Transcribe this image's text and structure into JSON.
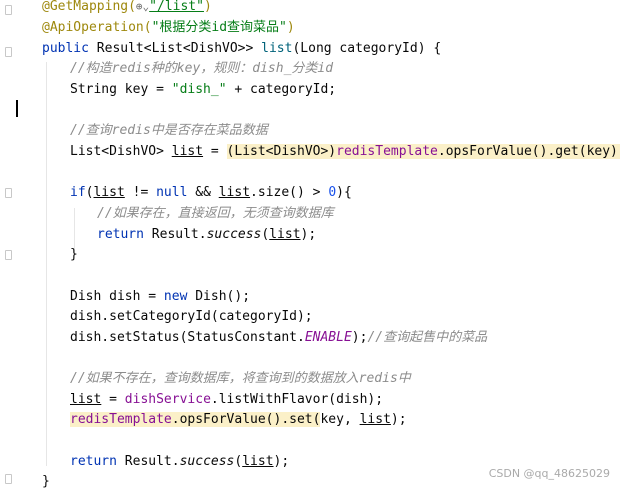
{
  "code": {
    "ann_getmapping": "@GetMapping(",
    "ann_getmapping_icon": "⊕⌄",
    "ann_getmapping_path": "\"/list\"",
    "ann_getmapping_close": ")",
    "ann_apiop": "@ApiOperation(",
    "ann_apiop_value": "\"根据分类id查询菜品\"",
    "ann_apiop_close": ")",
    "sig_public": "public",
    "sig_rest": " Result<List<DishVO>> ",
    "sig_method": "list",
    "sig_params": "(Long categoryId) {",
    "cmt_key": "//构造redis种的key，规则：dish_分类id",
    "key_decl": "String key = ",
    "key_str": "\"dish_\"",
    "key_rest": " + categoryId;",
    "cmt_query": "//查询redis中是否存在菜品数据",
    "list_type": "List<DishVO> ",
    "list_var": "list",
    "list_eq": " = ",
    "list_cast": "(List<DishVO>)",
    "list_tpl": "redisTemplate",
    "list_ops": ".opsForValue().get(key);",
    "if_kw": "if",
    "if_open": "(",
    "if_list1": "list",
    "if_ne": " != ",
    "if_null": "null",
    "if_and": " && ",
    "if_list2": "list",
    "if_size": ".size() > ",
    "if_zero": "0",
    "if_close": "){",
    "cmt_exists": "//如果存在，直接返回，无须查询数据库",
    "ret1_kw": "return",
    "ret1_a": " Result.",
    "ret1_success": "success",
    "ret1_b": "(",
    "ret1_list": "list",
    "ret1_c": ");",
    "close_brace": "}",
    "dish_a": "Dish dish = ",
    "dish_new": "new",
    "dish_b": " Dish();",
    "setcat": "dish.setCategoryId(categoryId);",
    "setstatus_a": "dish.setStatus(StatusConstant.",
    "setstatus_enable": "ENABLE",
    "setstatus_b": ");",
    "cmt_onsale": "//查询起售中的菜品",
    "cmt_notexist": "//如果不存在，查询数据库，将查询到的数据放入redis中",
    "assign_list": "list",
    "assign_eq": " = ",
    "assign_svc": "dishService",
    "assign_rest": ".listWithFlavor(dish);",
    "set_tpl": "redisTemplate",
    "set_ops": ".opsForValue().set(",
    "set_args_a": "key, ",
    "set_args_list": "list",
    "set_args_b": ");",
    "ret2_kw": "return",
    "ret2_a": " Result.",
    "ret2_success": "success",
    "ret2_b": "(",
    "ret2_list": "list",
    "ret2_c": ");",
    "final_brace": "}"
  },
  "watermark": "CSDN @qq_48625029",
  "colors": {
    "keyword": "#0033b3",
    "annotation": "#9e880d",
    "string": "#067d17",
    "comment": "#8c8c8c",
    "number": "#1750eb",
    "field": "#871094",
    "highlight": "#fbf0c8"
  }
}
